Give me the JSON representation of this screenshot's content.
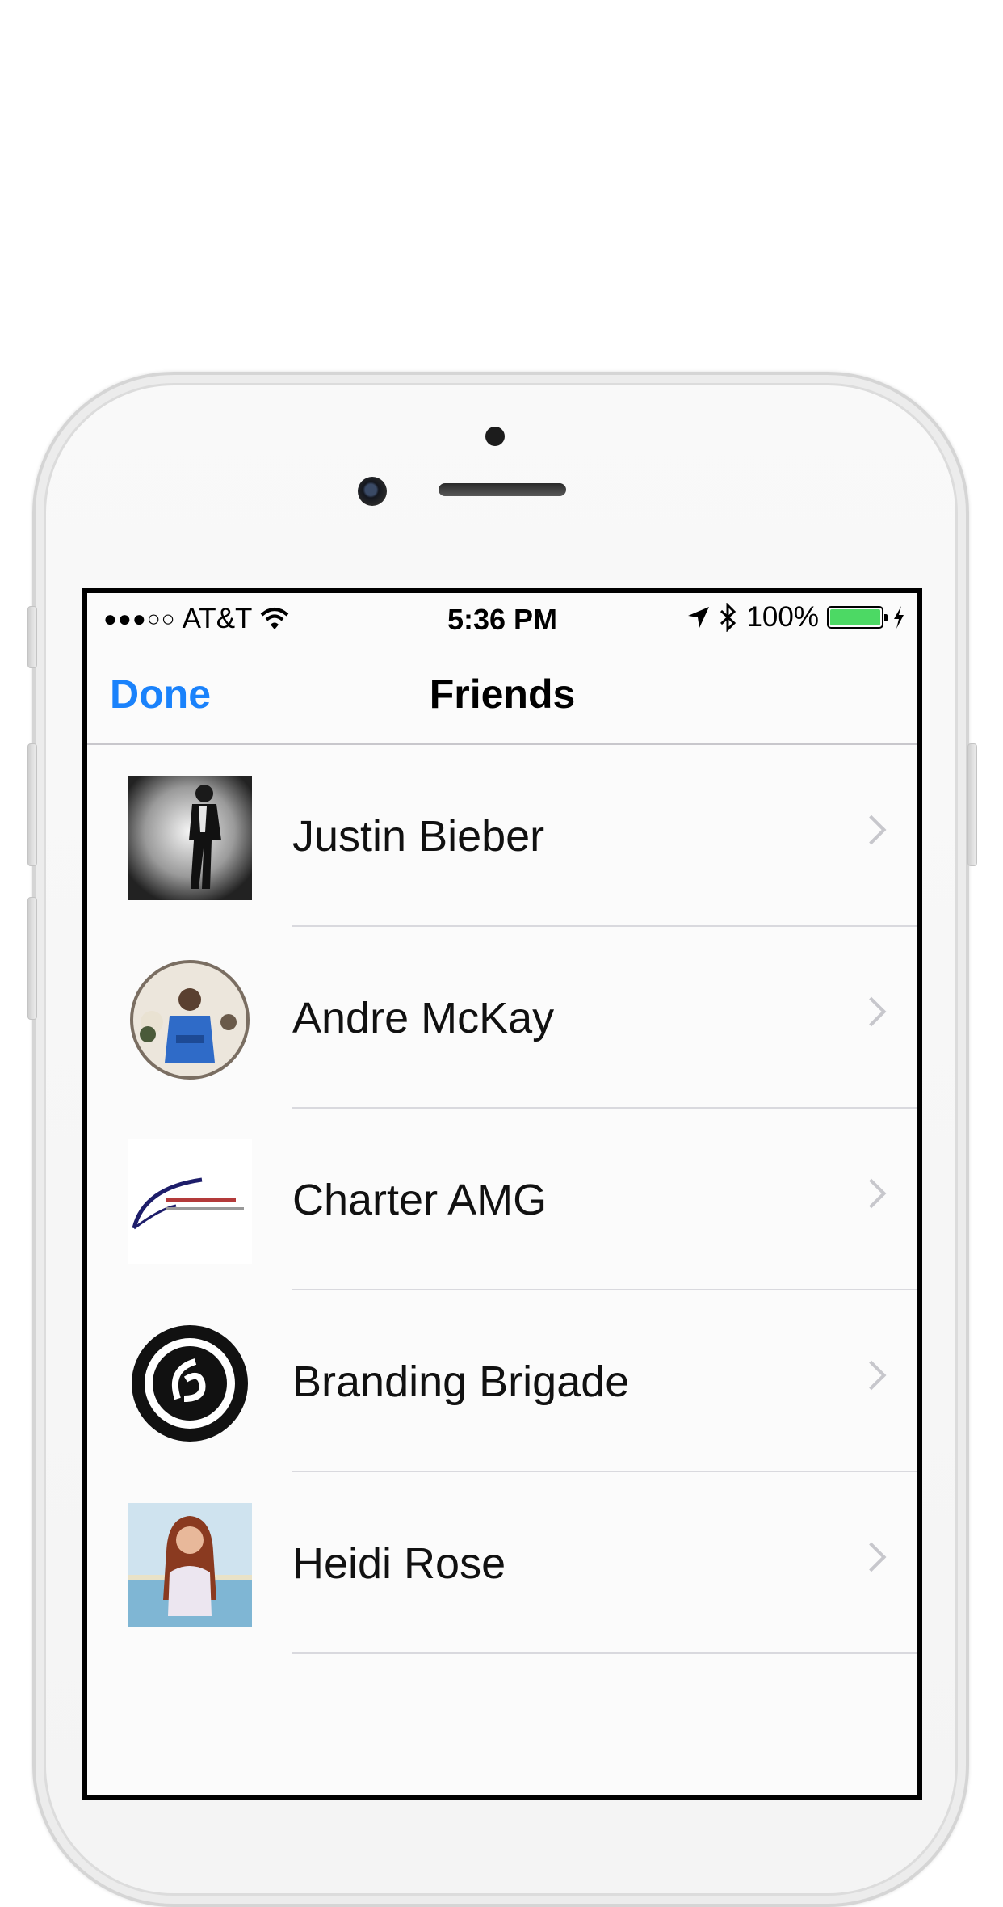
{
  "status_bar": {
    "signal": "●●●○○",
    "carrier": "AT&T",
    "wifi_icon": "wifi-icon",
    "time": "5:36 PM",
    "location_icon": "location-arrow-icon",
    "bluetooth_icon": "bluetooth-icon",
    "battery_text": "100%",
    "battery_level": 1.0,
    "battery_color": "#4cd964",
    "charging_icon": "lightning-bolt-icon"
  },
  "nav": {
    "done_label": "Done",
    "title": "Friends",
    "accent_color": "#1a82fb"
  },
  "friends": [
    {
      "name": "Justin Bieber"
    },
    {
      "name": "Andre McKay"
    },
    {
      "name": "Charter AMG"
    },
    {
      "name": "Branding Brigade"
    },
    {
      "name": "Heidi Rose"
    }
  ]
}
